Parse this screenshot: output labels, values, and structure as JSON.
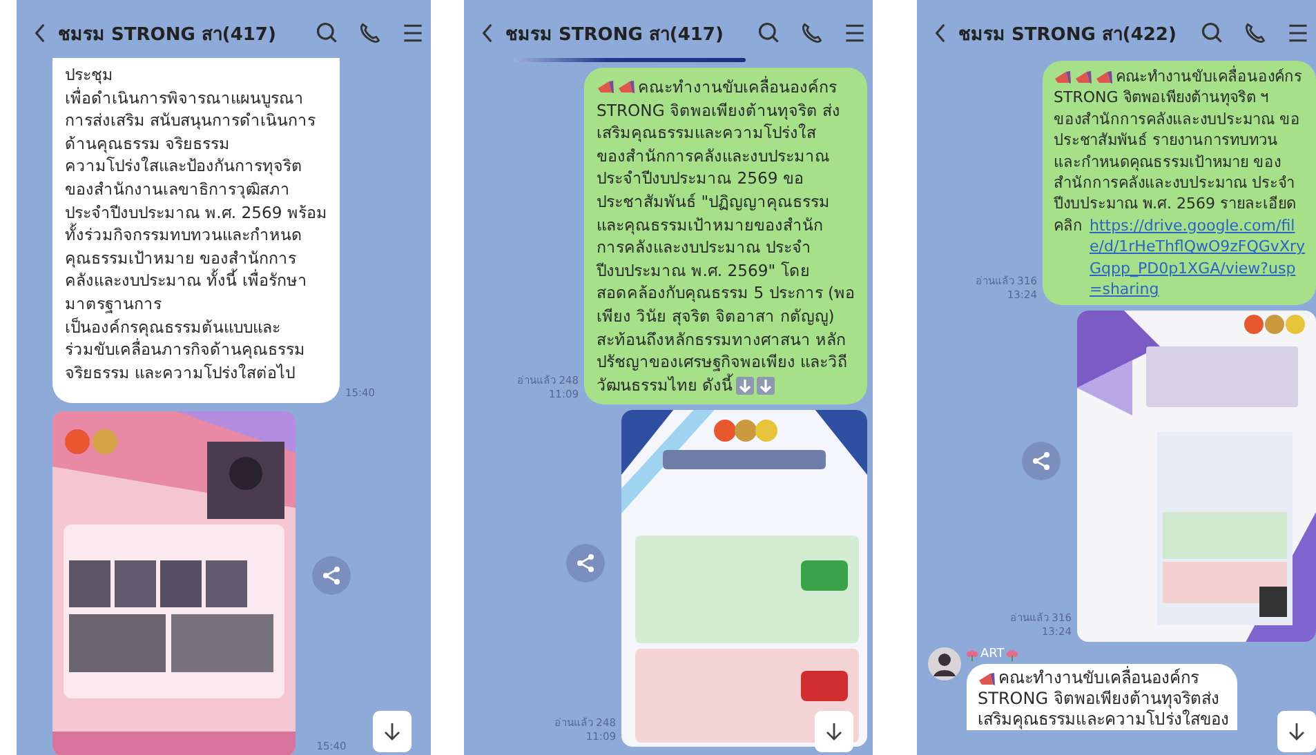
{
  "phones": [
    {
      "title": "ชมรม STRONG สา(417)",
      "loading_bar": false,
      "jump_button": true,
      "messages": [
        {
          "kind": "text",
          "outgoing": false,
          "lines": [
            "ประชุม",
            "เพื่อดำเนินการพิจารณาแผนบูรณา",
            "การส่งเสริม สนับสนุนการดำเนินการ",
            "ด้านคุณธรรม จริยธรรม",
            "ความโปร่งใสและป้องกันการทุจริต",
            "ของสำนักงานเลขาธิการวุฒิสภา",
            "ประจำปีงบประมาณ พ.ศ. 2569 พร้อม",
            "ทั้งร่วมกิจกรรมทบทวนและกำหนด",
            "คุณธรรมเป้าหมาย ของสำนักการ",
            "คลังและงบประมาณ ทั้งนี้ เพื่อรักษา",
            "มาตรฐานการ",
            "เป็นองค์กรคุณธรรมต้นแบบและ",
            "ร่วมขับเคลื่อนภารกิจด้านคุณธรรม",
            "จริยธรรม และความโปร่งใสต่อไป"
          ],
          "time": "15:40"
        },
        {
          "outgoing": false,
          "time": "15:40"
        }
      ]
    },
    {
      "title": "ชมรม STRONG สา(417)",
      "loading_bar": true,
      "jump_button": true,
      "messages": [
        {
          "kind": "text",
          "outgoing": true,
          "emoji_before": [
            {
              "kind": "megaphone"
            },
            {
              "kind": "megaphone"
            }
          ],
          "lines": [
            "คณะทำงานขับเคลื่อนองค์กร",
            "STRONG จิตพอเพียงต้านทุจริต ส่ง",
            "เสริมคุณธรรมและความโปร่งใส",
            "ของสำนักการคลังและงบประมาณ",
            "ประจำปีงบประมาณ 2569 ขอ",
            "ประชาสัมพันธ์ \"ปฏิญญาคุณธรรม",
            "และคุณธรรมเป้าหมายของสำนัก",
            "การคลังและงบประมาณ ประจำ",
            "ปีงบประมาณ พ.ศ. 2569\" โดย",
            "สอดคล้องกับคุณธรรม 5 ประการ (พอ",
            "เพียง วินัย สุจริต จิตอาสา กตัญญู)",
            "สะท้อนถึงหลักธรรมทางศาสนา หลัก",
            "ปรัชญาของเศรษฐกิจพอเพียง และวิถี",
            "วัฒนธรรมไทย ดังนี้"
          ],
          "emoji_after": [
            {
              "kind": "down-arrow"
            },
            {
              "kind": "down-arrow"
            }
          ],
          "read": "อ่านแล้ว 248",
          "time": "11:09"
        },
        {
          "outgoing": true,
          "read": "อ่านแล้ว 248",
          "time": "11:09"
        }
      ]
    },
    {
      "title": "ชมรม STRONG สา(422)",
      "loading_bar": false,
      "jump_button": true,
      "messages": [
        {
          "kind": "text",
          "outgoing": true,
          "emoji_before": [
            {
              "kind": "megaphone"
            },
            {
              "kind": "megaphone"
            },
            {
              "kind": "megaphone"
            }
          ],
          "lines": [
            "คณะทำงานขับเคลื่อนองค์กร",
            "STRONG จิตพอเพียงต้านทุจริต ฯ",
            "ของสำนักการคลังและงบประมาณ ขอ",
            "ประชาสัมพันธ์ รายงานการทบทวน",
            "และกำหนดคุณธรรมเป้าหมาย ของ",
            "สำนักการคลังและงบประมาณ ประจำ",
            "ปีงบประมาณ พ.ศ. 2569 รายละเอียด",
            "คลิก"
          ],
          "link": "https://drive.google.com/file/d/1rHeThflQwO9zFQGvXryGqpp_PD0p1XGA/view?usp=sharing",
          "read": "อ่านแล้ว 316",
          "time": "13:24"
        },
        {
          "outgoing": true,
          "read": "อ่านแล้ว 316",
          "time": "13:24"
        },
        {
          "kind": "text",
          "outgoing": false,
          "sender": {
            "name": "ART",
            "decor": [
              {
                "kind": "flower"
              },
              {
                "kind": "flower"
              }
            ]
          },
          "emoji_before": [
            {
              "kind": "megaphone"
            }
          ],
          "lines": [
            "คณะทำงานขับเคลื่อนองค์กร",
            "STRONG จิตพอเพียงต้านทุจริตส่ง",
            "เสริมคุณธรรมและความโปร่งใสของ"
          ]
        }
      ]
    }
  ]
}
